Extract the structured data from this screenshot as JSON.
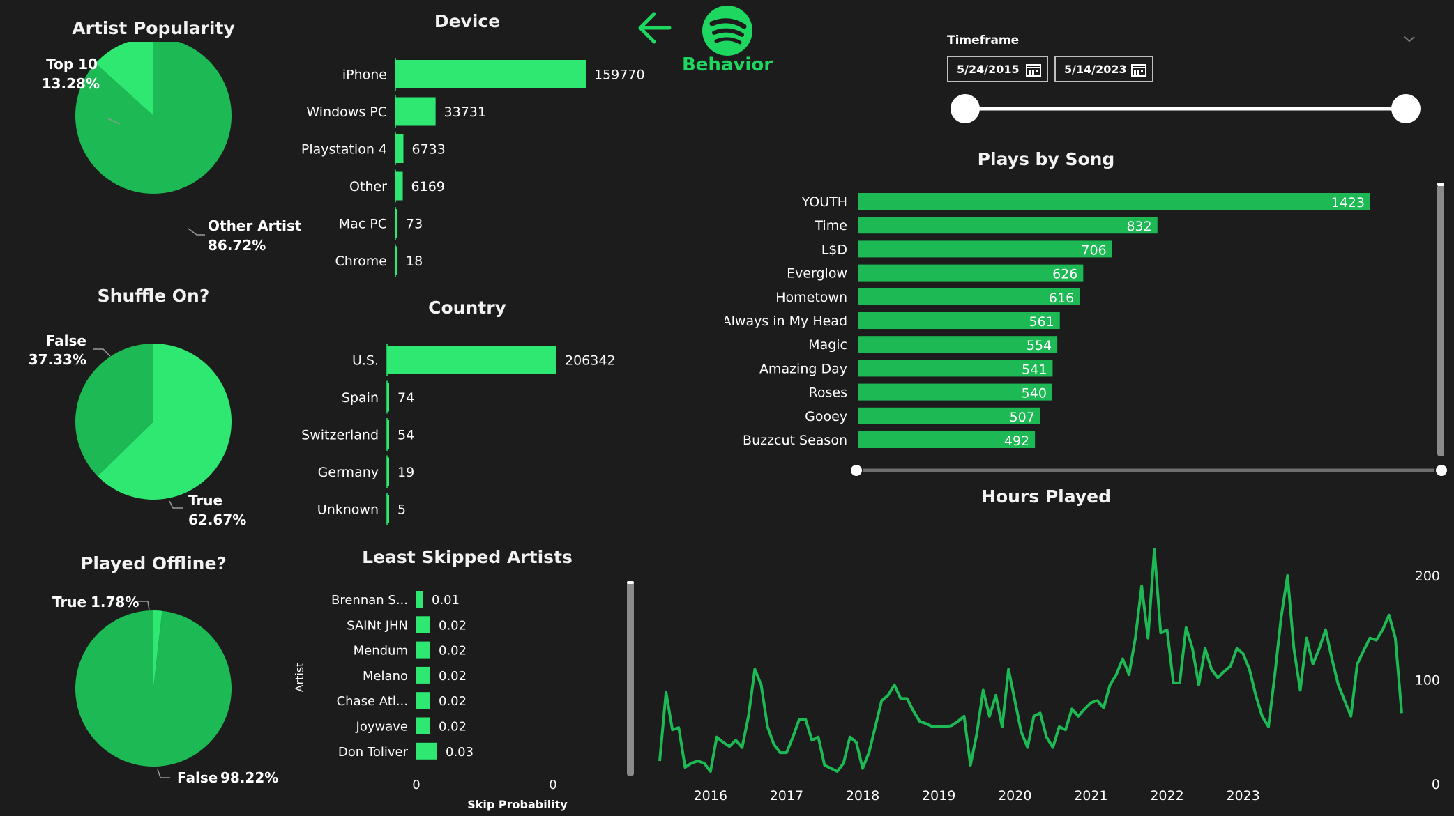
{
  "header": {
    "title": "Behavior",
    "back_icon": "arrow-left-icon",
    "logo_icon": "spotify-logo-icon",
    "accent": "#1ed760",
    "accent_dark": "#1db954"
  },
  "timeframe": {
    "label": "Timeframe",
    "start": "5/24/2015",
    "end": "5/14/2023",
    "chevron_icon": "chevron-down-icon",
    "calendar_icon": "calendar-icon",
    "slider_start": 0,
    "slider_end": 1
  },
  "artist_popularity": {
    "title": "Artist Popularity",
    "chart_data": {
      "type": "pie",
      "slices": [
        {
          "label": "Top 10",
          "value": 13.28,
          "display": "13.28%",
          "color": "#2ee872"
        },
        {
          "label": "Other Artist",
          "value": 86.72,
          "display": "86.72%",
          "color": "#1db954"
        }
      ]
    }
  },
  "shuffle": {
    "title": "Shuffle On?",
    "chart_data": {
      "type": "pie",
      "slices": [
        {
          "label": "True",
          "value": 62.67,
          "display": "62.67%",
          "color": "#2ee872"
        },
        {
          "label": "False",
          "value": 37.33,
          "display": "37.33%",
          "color": "#1db954"
        }
      ]
    }
  },
  "offline": {
    "title": "Played Offline?",
    "chart_data": {
      "type": "pie",
      "slices": [
        {
          "label": "True",
          "value": 1.78,
          "display": "1.78%",
          "color": "#2ee872"
        },
        {
          "label": "False",
          "value": 98.22,
          "display": "98.22%",
          "color": "#1db954"
        }
      ]
    }
  },
  "device": {
    "title": "Device",
    "chart_data": {
      "type": "bar",
      "categories": [
        "iPhone",
        "Windows PC",
        "Playstation 4",
        "Other",
        "Mac PC",
        "Chrome"
      ],
      "values": [
        159770,
        33731,
        6733,
        6169,
        73,
        18
      ]
    }
  },
  "country": {
    "title": "Country",
    "chart_data": {
      "type": "bar",
      "categories": [
        "U.S.",
        "Spain",
        "Switzerland",
        "Germany",
        "Unknown"
      ],
      "values": [
        206342,
        74,
        54,
        19,
        5
      ]
    }
  },
  "least_skipped": {
    "title": "Least Skipped Artists",
    "chart_data": {
      "type": "bar",
      "categories": [
        "Brennan S...",
        "SAINt JHN",
        "Mendum",
        "Melano",
        "Chase Atl...",
        "Joywave",
        "Don Toliver"
      ],
      "values": [
        0.01,
        0.02,
        0.02,
        0.02,
        0.02,
        0.02,
        0.03
      ],
      "value_labels": [
        "0.01",
        "0.02",
        "0.02",
        "0.02",
        "0.02",
        "0.02",
        "0.03"
      ],
      "xlabel": "Skip Probability",
      "ylabel": "Artist",
      "x_ticks": [
        "0",
        "0"
      ]
    }
  },
  "plays_by_song": {
    "title": "Plays by Song",
    "chart_data": {
      "type": "bar",
      "categories": [
        "YOUTH",
        "Time",
        "L$D",
        "Everglow",
        "Hometown",
        "Always in My Head",
        "Magic",
        "Amazing Day",
        "Roses",
        "Gooey",
        "Buzzcut Season"
      ],
      "values": [
        1423,
        832,
        706,
        626,
        616,
        561,
        554,
        541,
        540,
        507,
        492
      ]
    }
  },
  "hours_played": {
    "title": "Hours Played",
    "chart_data": {
      "type": "line",
      "x_start": "2015-05",
      "x_step": "month",
      "x_ticks": [
        "2016",
        "2017",
        "2018",
        "2019",
        "2020",
        "2021",
        "2022",
        "2023"
      ],
      "y_ticks": [
        "200",
        "100",
        "0"
      ],
      "ylim": [
        0,
        220
      ],
      "values": [
        22,
        88,
        52,
        54,
        16,
        20,
        22,
        20,
        12,
        45,
        40,
        36,
        42,
        35,
        65,
        110,
        95,
        55,
        38,
        30,
        30,
        45,
        62,
        62,
        42,
        45,
        18,
        15,
        12,
        20,
        45,
        40,
        15,
        30,
        55,
        80,
        85,
        95,
        82,
        82,
        70,
        60,
        58,
        55,
        55,
        55,
        56,
        60,
        65,
        18,
        48,
        90,
        65,
        85,
        55,
        110,
        80,
        50,
        35,
        65,
        68,
        45,
        35,
        55,
        52,
        72,
        65,
        72,
        78,
        80,
        73,
        95,
        105,
        120,
        105,
        140,
        190,
        140,
        225,
        145,
        148,
        97,
        97,
        150,
        130,
        95,
        130,
        110,
        102,
        108,
        113,
        130,
        125,
        110,
        85,
        65,
        55,
        105,
        160,
        200,
        130,
        90,
        140,
        115,
        130,
        148,
        120,
        95,
        80,
        65,
        115,
        128,
        140,
        138,
        148,
        162,
        140,
        68
      ]
    }
  }
}
